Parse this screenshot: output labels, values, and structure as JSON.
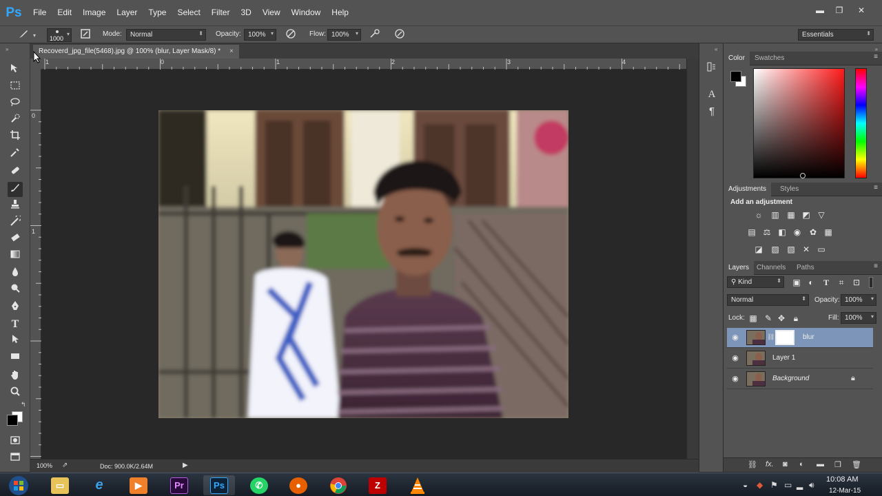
{
  "app": {
    "logo": "Ps"
  },
  "menu": [
    "File",
    "Edit",
    "Image",
    "Layer",
    "Type",
    "Select",
    "Filter",
    "3D",
    "View",
    "Window",
    "Help"
  ],
  "window_controls": {
    "minimize": "▬",
    "restore": "❐",
    "close": "✕"
  },
  "options_bar": {
    "brush_size": "1000",
    "mode_label": "Mode:",
    "mode_value": "Normal",
    "opacity_label": "Opacity:",
    "opacity_value": "100%",
    "flow_label": "Flow:",
    "flow_value": "100%",
    "workspace": "Essentials"
  },
  "document": {
    "tab_title": "Recoverd_jpg_file(5468).jpg @ 100% (blur, Layer Mask/8) *",
    "close": "×",
    "ruler_h": [
      "1",
      "0",
      "1",
      "2",
      "3",
      "4"
    ],
    "ruler_v": [
      "0",
      "1"
    ]
  },
  "status": {
    "zoom": "100%",
    "doc": "Doc: 900.0K/2.64M"
  },
  "color_panel": {
    "tabs": [
      "Color",
      "Swatches"
    ]
  },
  "adjustments_panel": {
    "tabs": [
      "Adjustments",
      "Styles"
    ],
    "heading": "Add an adjustment"
  },
  "layers_panel": {
    "tabs": [
      "Layers",
      "Channels",
      "Paths"
    ],
    "filter": "Kind",
    "blend_mode": "Normal",
    "opacity_label": "Opacity:",
    "opacity_value": "100%",
    "lock_label": "Lock:",
    "fill_label": "Fill:",
    "fill_value": "100%",
    "layers": [
      {
        "name": "blur",
        "selected": true
      },
      {
        "name": "Layer 1",
        "selected": false
      },
      {
        "name": "Background",
        "selected": false
      }
    ]
  },
  "taskbar": {
    "clock_time": "10:08 AM",
    "clock_date": "12-Mar-15",
    "apps": [
      "start",
      "explorer",
      "internet-explorer",
      "media",
      "premiere",
      "photoshop",
      "whatsapp",
      "firefox",
      "chrome",
      "filezilla",
      "vlc"
    ],
    "premiere_label": "Pr",
    "photoshop_label": "Ps"
  },
  "colors": {
    "accent": "#31a8ff",
    "selection": "#7d95b8"
  }
}
